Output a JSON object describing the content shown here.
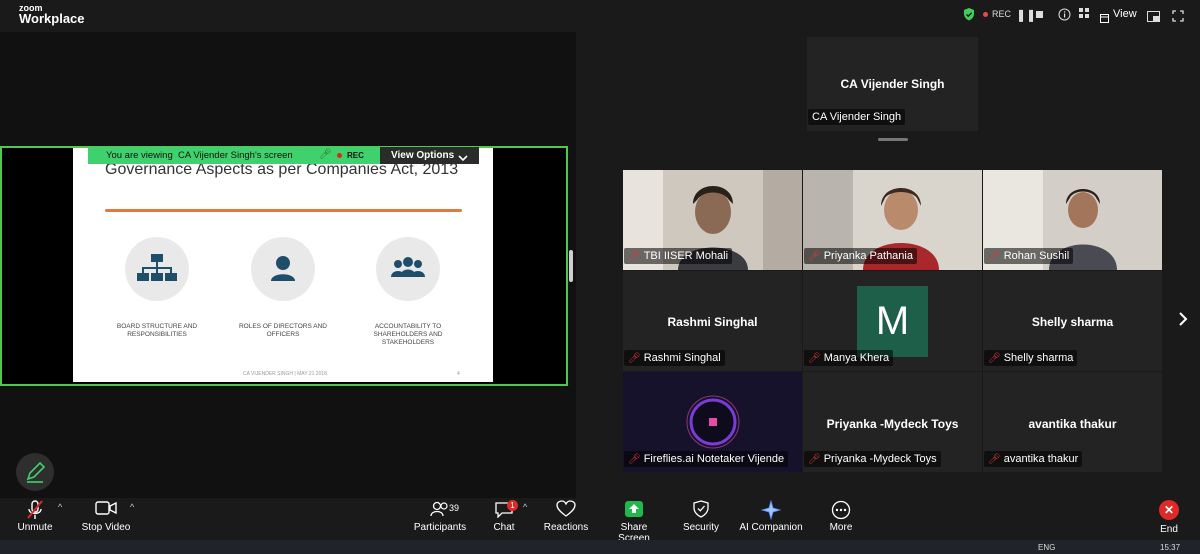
{
  "app": {
    "logo_small": "zoom",
    "logo_big": "Workplace"
  },
  "topbar": {
    "rec": "REC",
    "view": "View",
    "icons": [
      "shield-check-icon",
      "rec-icon",
      "pause-icon",
      "stop-icon",
      "info-icon",
      "view-icon",
      "minimize-icon",
      "maximize-icon",
      "close-icon"
    ]
  },
  "share": {
    "banner_prefix": "You are viewing",
    "banner_name": "CA Vijender Singh's screen",
    "banner_rec": "REC",
    "view_options": "View Options",
    "slide": {
      "title": "Governance Aspects as per Companies Act, 2013",
      "items": [
        {
          "icon": "org-chart-icon",
          "caption": "BOARD STRUCTURE AND RESPONSIBILITIES"
        },
        {
          "icon": "person-icon",
          "caption": "ROLES OF DIRECTORS AND OFFICERS"
        },
        {
          "icon": "group-icon",
          "caption": "ACCOUNTABILITY TO SHAREHOLDERS AND STAKEHOLDERS"
        }
      ],
      "footer": "CA VIJENDER SINGH | MAY 21 2018",
      "page": "4"
    }
  },
  "speaker": {
    "name": "CA Vijender Singh",
    "tag": "CA Vijender Singh"
  },
  "participants": [
    {
      "tag": "TBI IISER Mohali"
    },
    {
      "tag": "Priyanka Pathania"
    },
    {
      "tag": "Rohan Sushil"
    },
    {
      "center": "Rashmi Singhal",
      "tag": "Rashmi Singhal"
    },
    {
      "avatar": "M",
      "tag": "Manya Khera"
    },
    {
      "center": "Shelly sharma",
      "tag": "Shelly sharma"
    },
    {
      "tag": "Fireflies.ai Notetaker Vijende"
    },
    {
      "center": "Priyanka -Mydeck Toys",
      "tag": "Priyanka -Mydeck Toys"
    },
    {
      "center": "avantika thakur",
      "tag": "avantika thakur"
    }
  ],
  "toolbar": {
    "unmute": "Unmute",
    "stop_video": "Stop Video",
    "participants": "Participants",
    "participants_count": "39",
    "chat": "Chat",
    "chat_badge": "1",
    "reactions": "Reactions",
    "share_screen": "Share Screen",
    "security": "Security",
    "ai_companion": "AI Companion",
    "more": "More",
    "end": "End"
  },
  "taskbar": {
    "lang": "ENG",
    "time": "15:37"
  },
  "colors": {
    "share_border": "#4fc84f",
    "banner": "#3fd16d",
    "rec": "#e34b4b",
    "avatar_bg": "#1e5f4a",
    "end": "#e02828"
  }
}
